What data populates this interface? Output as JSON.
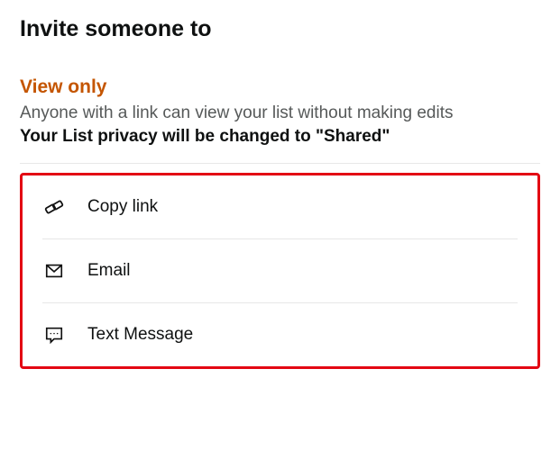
{
  "header": {
    "title": "Invite someone to"
  },
  "section": {
    "heading": "View only",
    "description": "Anyone with a link can view your list without making edits",
    "privacy_note": "Your List privacy will be changed to \"Shared\""
  },
  "share_options": {
    "copy_link": {
      "label": "Copy link"
    },
    "email": {
      "label": "Email"
    },
    "text_message": {
      "label": "Text Message"
    }
  }
}
